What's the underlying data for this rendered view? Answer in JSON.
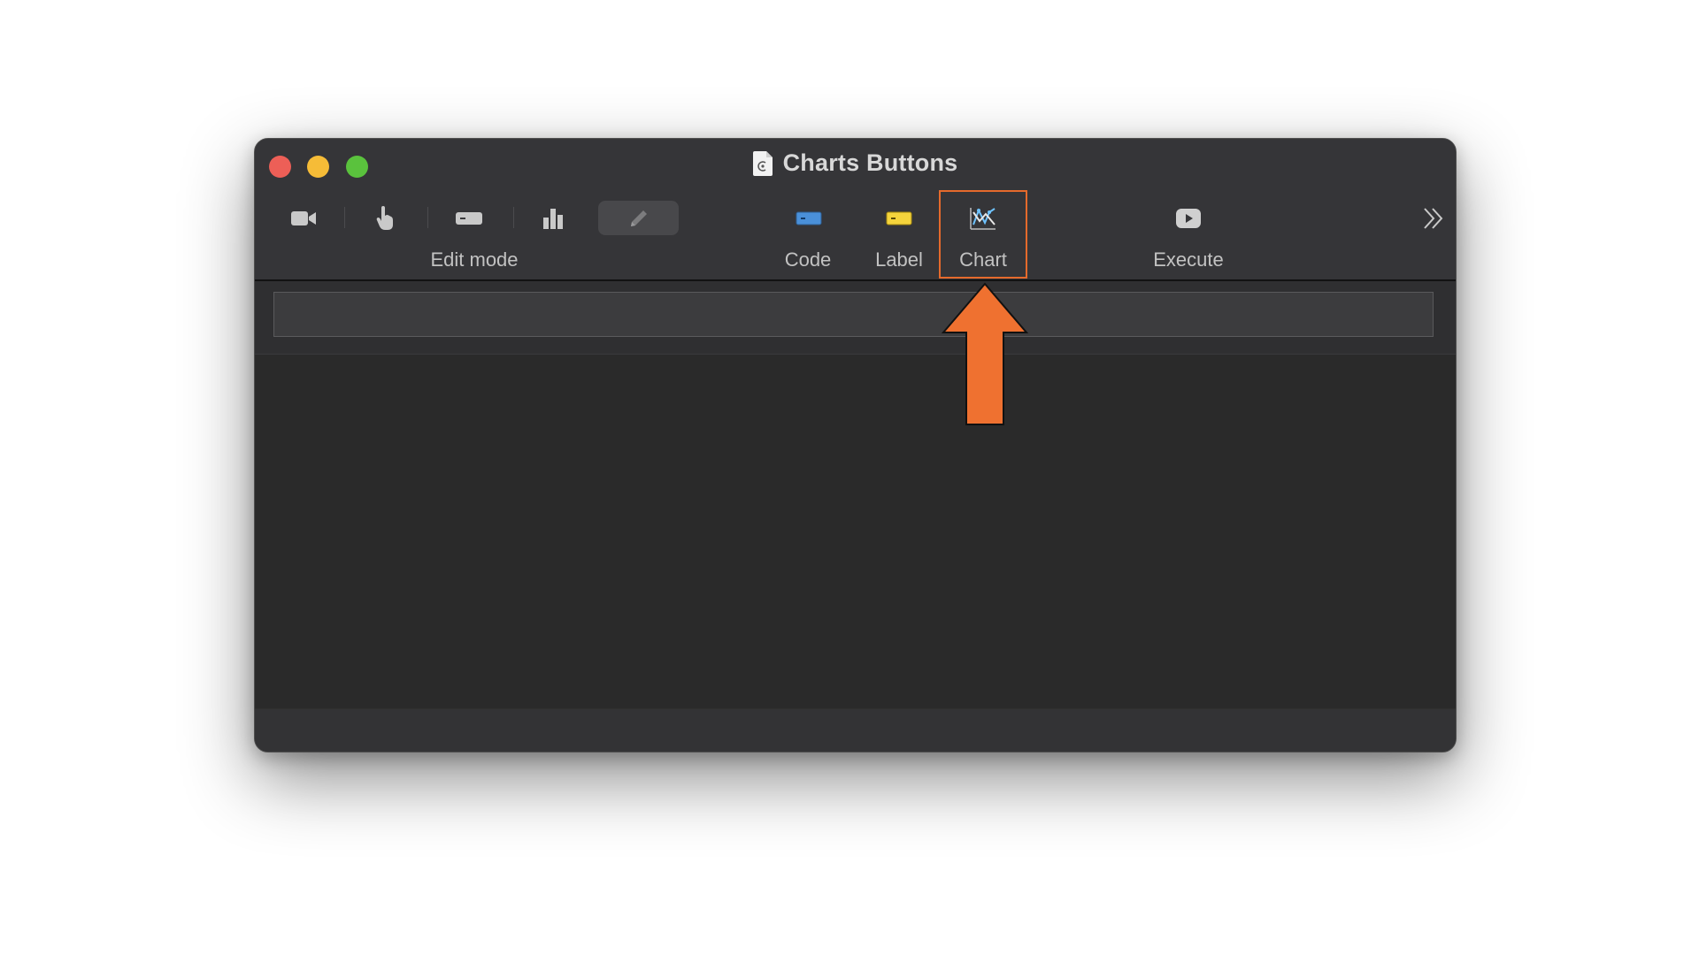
{
  "window": {
    "title": "Charts Buttons",
    "title_icon": "document-app-icon"
  },
  "traffic_lights": {
    "close_color": "#ed5f57",
    "minimize_color": "#f6bc37",
    "maximize_color": "#5ac23d"
  },
  "toolbar": {
    "edit_mode_label": "Edit mode",
    "tools": [
      {
        "icon": "video-camera-icon"
      },
      {
        "icon": "pointer-hand-icon"
      },
      {
        "icon": "button-shape-icon"
      },
      {
        "icon": "bar-chart-icon"
      },
      {
        "icon": "pencil-icon",
        "selected": true
      }
    ],
    "code_label": "Code",
    "label_label": "Label",
    "chart_label": "Chart",
    "execute_label": "Execute",
    "overflow_icon": "double-chevron-right-icon",
    "accent_code": "#4a90d9",
    "accent_label": "#f5d43c",
    "highlight_color": "#e56a2c"
  },
  "search": {
    "value": ""
  },
  "annotation": {
    "arrow_color": "#ef7130",
    "target": "Chart"
  }
}
